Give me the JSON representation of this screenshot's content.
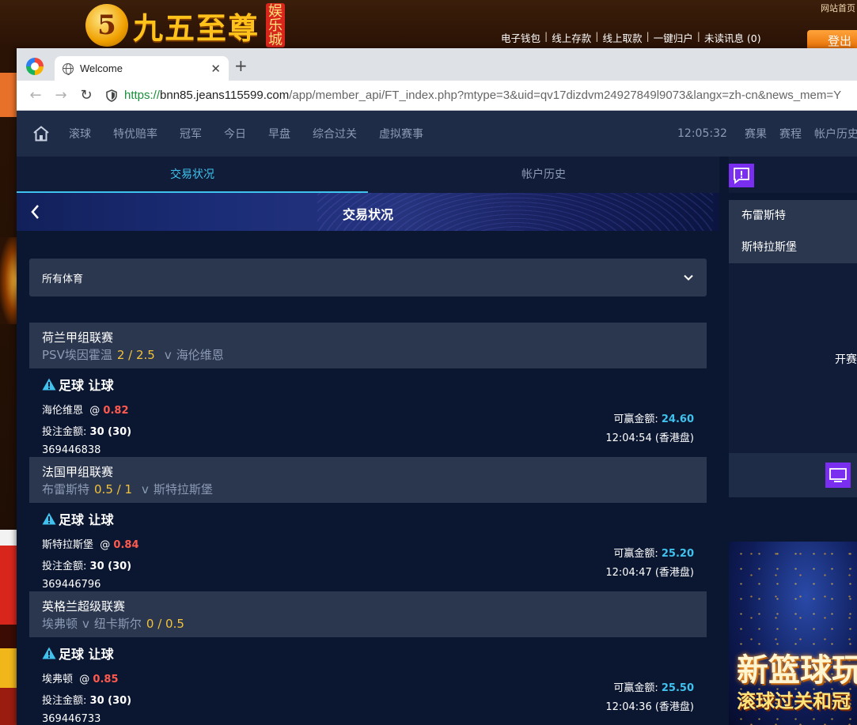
{
  "bg": {
    "logo_mark": "5",
    "logo_text": "九五至尊",
    "logo_tag": "娱乐城",
    "top_right": "网站首页",
    "links": [
      "电子钱包",
      "线上存款",
      "线上取款",
      "一键归户",
      "未读讯息 (0)"
    ],
    "logout": "登出"
  },
  "browser": {
    "tab_title": "Welcome",
    "url_proto": "https://",
    "url_host": "bnn85.jeans115599.com",
    "url_path": "/app/member_api/FT_index.php?mtype=3&uid=qv17dizdvm24927849l9073&langx=zh-cn&news_mem=Y"
  },
  "nav": {
    "items": [
      "滚球",
      "特优赔率",
      "冠军",
      "今日",
      "早盘",
      "综合过关",
      "虚拟赛事"
    ],
    "time": "12:05:32",
    "right": [
      "赛果",
      "赛程",
      "帐户历史"
    ]
  },
  "subtabs": [
    "交易状况",
    "帐户历史"
  ],
  "banner_title": "交易状况",
  "filter_label": "所有体育",
  "labels": {
    "stake": "投注金额:",
    "win": "可赢金额:",
    "at": "@",
    "vs": "v"
  },
  "bets": [
    {
      "league": "荷兰甲组联赛",
      "home": "PSV埃因霍温",
      "handicap": "2 / 2.5",
      "away": "海伦维恩",
      "market": "足球 让球",
      "selection": "海伦维恩",
      "odds": "0.82",
      "stake": "30 (30)",
      "win": "24.60",
      "id": "369446838",
      "time": "12:04:54 (香港盘)"
    },
    {
      "league": "法国甲组联赛",
      "home": "布雷斯特",
      "handicap": "0.5 / 1",
      "away": "斯特拉斯堡",
      "market": "足球 让球",
      "selection": "斯特拉斯堡",
      "odds": "0.84",
      "stake": "30 (30)",
      "win": "25.20",
      "id": "369446796",
      "time": "12:04:47 (香港盘)"
    },
    {
      "league": "英格兰超级联赛",
      "home": "埃弗顿",
      "away": "纽卡斯尔",
      "handicap": "0 / 0.5",
      "market": "足球 让球",
      "selection": "埃弗顿",
      "odds": "0.85",
      "stake": "30 (30)",
      "win": "25.50",
      "id": "369446733",
      "time": "12:04:36 (香港盘)"
    }
  ],
  "side": {
    "items": [
      "布雷斯特",
      "斯特拉斯堡"
    ],
    "open_text": "开赛",
    "promo_line1": "新篮球玩",
    "promo_line2": "滚球过关和冠"
  }
}
